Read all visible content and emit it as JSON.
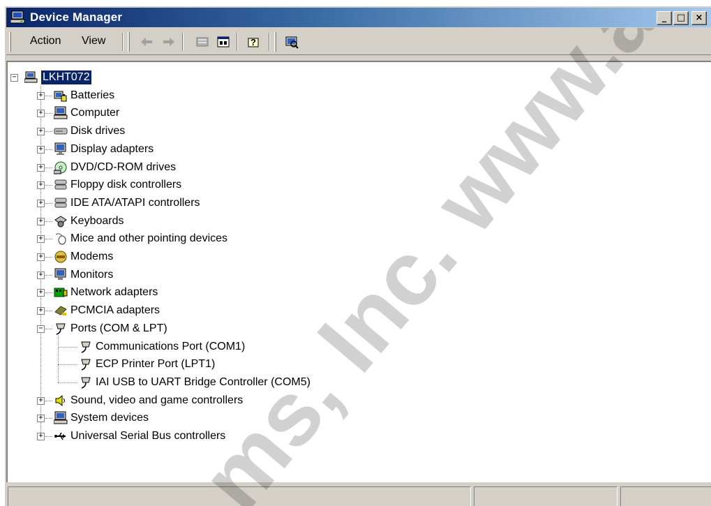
{
  "window": {
    "title": "Device Manager"
  },
  "titlebar_buttons": {
    "minimize": "_",
    "maximize": "□",
    "close": "×"
  },
  "menu": {
    "action": "Action",
    "view": "View"
  },
  "toolbar_icons": [
    "back-arrow-icon",
    "forward-arrow-icon",
    "up-folder-icon",
    "properties-icon",
    "help-icon",
    "scan-hardware-icon"
  ],
  "tree": {
    "root": "LKHT072",
    "items": [
      {
        "label": "Batteries",
        "icon": "battery-icon"
      },
      {
        "label": "Computer",
        "icon": "computer-icon"
      },
      {
        "label": "Disk drives",
        "icon": "disk-drive-icon"
      },
      {
        "label": "Display adapters",
        "icon": "display-adapter-icon"
      },
      {
        "label": "DVD/CD-ROM drives",
        "icon": "dvd-drive-icon"
      },
      {
        "label": "Floppy disk controllers",
        "icon": "floppy-controller-icon"
      },
      {
        "label": "IDE ATA/ATAPI controllers",
        "icon": "ide-controller-icon"
      },
      {
        "label": "Keyboards",
        "icon": "keyboard-icon"
      },
      {
        "label": "Mice and other pointing devices",
        "icon": "mouse-icon"
      },
      {
        "label": "Modems",
        "icon": "modem-icon"
      },
      {
        "label": "Monitors",
        "icon": "monitor-icon"
      },
      {
        "label": "Network adapters",
        "icon": "network-adapter-icon"
      },
      {
        "label": "PCMCIA adapters",
        "icon": "pcmcia-icon"
      },
      {
        "label": "Ports (COM & LPT)",
        "icon": "port-icon",
        "expanded": true,
        "children": [
          {
            "label": "Communications Port (COM1)",
            "icon": "port-icon"
          },
          {
            "label": "ECP Printer Port (LPT1)",
            "icon": "port-icon"
          },
          {
            "label": "IAI USB to UART Bridge Controller (COM5)",
            "icon": "port-icon"
          }
        ]
      },
      {
        "label": "Sound, video and game controllers",
        "icon": "speaker-icon"
      },
      {
        "label": "System devices",
        "icon": "system-devices-icon"
      },
      {
        "label": "Universal Serial Bus controllers",
        "icon": "usb-icon"
      }
    ]
  },
  "watermark": {
    "text": "ms, Inc. www.airoil"
  },
  "colors": {
    "titlebar_start": "#0a246a",
    "titlebar_end": "#a6caf0",
    "face": "#d4d0c8",
    "selection": "#0a246a"
  }
}
